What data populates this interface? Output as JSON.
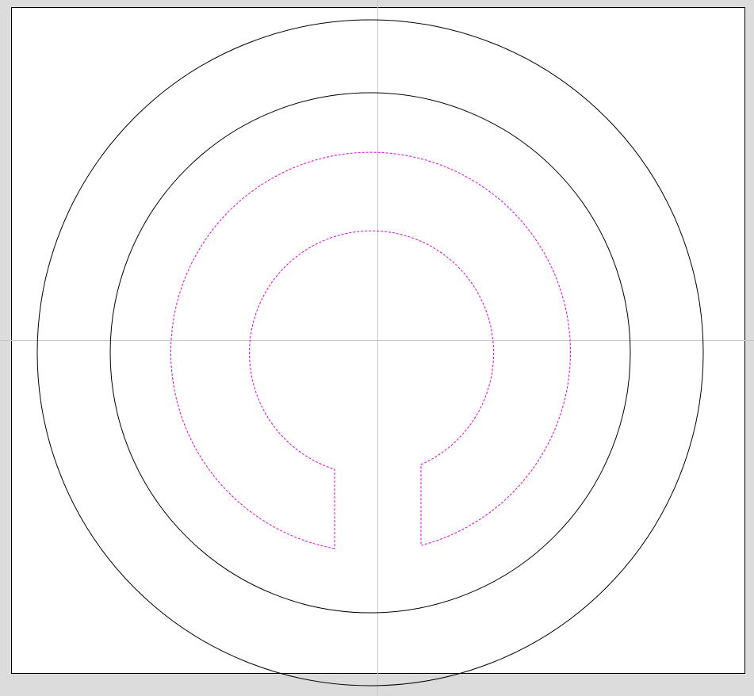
{
  "colors": {
    "workspace_background": "#dcdcdc",
    "canvas_background": "#ffffff",
    "canvas_border": "#000000",
    "guide_lines": "#c8c8c8",
    "solid_outline": "#000000",
    "dashed_outline": "#e000e0"
  },
  "shapes": {
    "outer_circle": "solid",
    "middle_circle": "solid",
    "inner_slotted_outline": "dashed"
  }
}
